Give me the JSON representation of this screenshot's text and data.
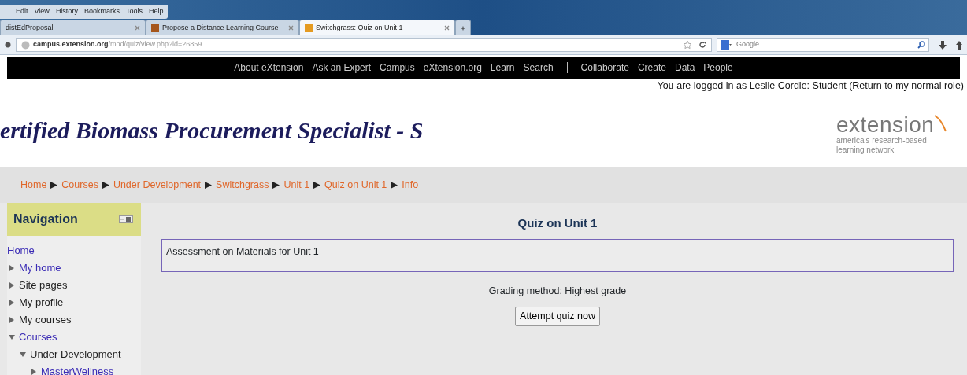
{
  "browser": {
    "menu": [
      "Edit",
      "View",
      "History",
      "Bookmarks",
      "Tools",
      "Help"
    ],
    "tabs": [
      {
        "title": "distEdProposal",
        "selected": false
      },
      {
        "title": "Propose a Distance Learning Course –",
        "selected": false
      },
      {
        "title": "Switchgrass: Quiz on Unit 1",
        "selected": true
      }
    ],
    "url": {
      "host": "campus.extension.org",
      "path": "/mod/quiz/view.php?id=26859"
    },
    "search": {
      "placeholder": "Google"
    }
  },
  "site_nav": [
    [
      "About eXtension",
      "Ask an Expert",
      "Campus",
      "eXtension.org",
      "Learn",
      "Search"
    ],
    [
      "Collaborate",
      "Create",
      "Data",
      "People"
    ]
  ],
  "login_info": {
    "text": "You are logged in as Leslie Cordie: Student",
    "link": "(Return to my normal role)"
  },
  "header": {
    "title": "ertified Biomass Procurement Specialist - S",
    "logo": "extension",
    "tagline": [
      "america's research-based",
      "learning network"
    ]
  },
  "breadcrumb": [
    "Home",
    "Courses",
    "Under Development",
    "Switchgrass",
    "Unit 1",
    "Quiz on Unit 1",
    "Info"
  ],
  "navigation": {
    "title": "Navigation",
    "items": [
      {
        "label": "Home",
        "kind": "leaf",
        "link": true
      },
      {
        "label": "My home",
        "kind": "branch",
        "expanded": false,
        "link": true
      },
      {
        "label": "Site pages",
        "kind": "branch",
        "expanded": false,
        "link": false
      },
      {
        "label": "My profile",
        "kind": "branch",
        "expanded": false,
        "link": false
      },
      {
        "label": "My courses",
        "kind": "branch",
        "expanded": false,
        "link": false
      },
      {
        "label": "Courses",
        "kind": "branch",
        "expanded": true,
        "link": true,
        "children": [
          {
            "label": "Under Development",
            "kind": "branch",
            "expanded": true,
            "link": false,
            "children": [
              {
                "label": "MasterWellness",
                "kind": "branch",
                "expanded": false,
                "link": true
              }
            ]
          }
        ]
      }
    ]
  },
  "main": {
    "heading": "Quiz on Unit 1",
    "intro": "Assessment on Materials for Unit 1",
    "grading": "Grading method: Highest grade",
    "button": "Attempt quiz now"
  }
}
